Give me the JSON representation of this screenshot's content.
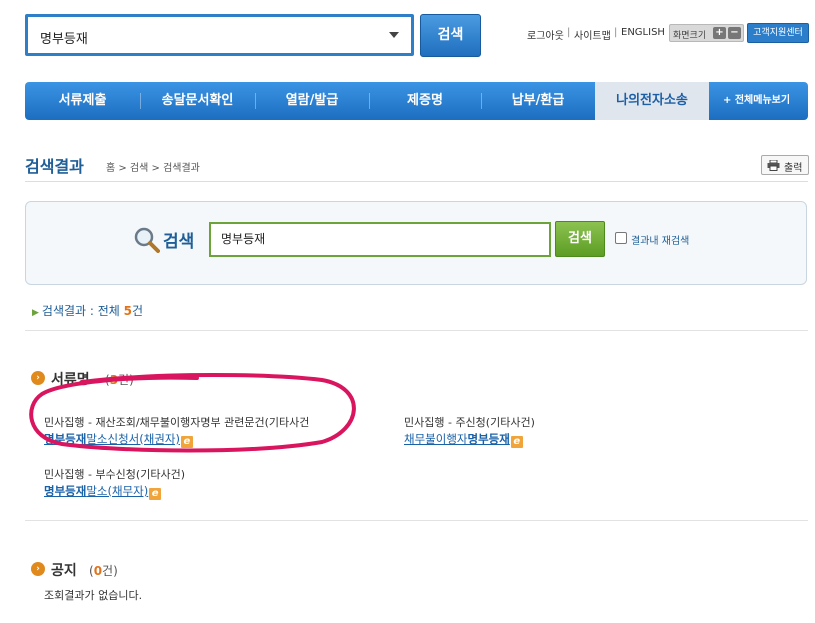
{
  "top_search": {
    "selected": "명부등재",
    "button": "검색"
  },
  "utility": {
    "logout": "로그아웃",
    "sep1": "|",
    "sitemap": "사이트맵",
    "sep2": "|",
    "english": "ENGLISH",
    "zoom_label": "화면크기",
    "zoom_in": "+",
    "zoom_out": "−",
    "support": "고객지원센터"
  },
  "nav": {
    "items": [
      {
        "label": "서류제출"
      },
      {
        "label": "송달문서확인"
      },
      {
        "label": "열람/발급"
      },
      {
        "label": "제증명"
      },
      {
        "label": "납부/환급"
      },
      {
        "label": "나의전자소송"
      }
    ],
    "all_menu": "+ 전체메뉴보기"
  },
  "page": {
    "title": "검색결과",
    "breadcrumb": "홈 > 검색 > 검색결과",
    "print": "출력"
  },
  "search_panel": {
    "label": "검색",
    "input_value": "명부등재",
    "button": "검색",
    "re_search_label": "결과내 재검색"
  },
  "summary": {
    "prefix": "검색결과 : 전체 ",
    "count": "5",
    "suffix": "건"
  },
  "sections": {
    "docs": {
      "title": "서류명",
      "count_open": "(",
      "count": "3",
      "count_close": "건)",
      "results": [
        {
          "category": "민사집행 - 재산조회/채무불이행자명부 관련문건(기타사건",
          "hl": "명부등재",
          "rest": "말소신청서(채권자)"
        },
        {
          "category": "민사집행 - 주신청(기타사건)",
          "pre": "채무불이행자",
          "hl": "명부등재",
          "rest": ""
        },
        {
          "category": "민사집행 - 부수신청(기타사건)",
          "hl": "명부등재",
          "rest": "말소(채무자)"
        }
      ]
    },
    "notice": {
      "title": "공지",
      "count_open": "(",
      "count": "0",
      "count_close": "건)",
      "empty": "조회결과가 없습니다."
    }
  },
  "colors": {
    "nav": "#1c6ec0",
    "accent_green": "#6ca43b",
    "count_orange": "#e0731b",
    "annotation": "#d8155e"
  }
}
